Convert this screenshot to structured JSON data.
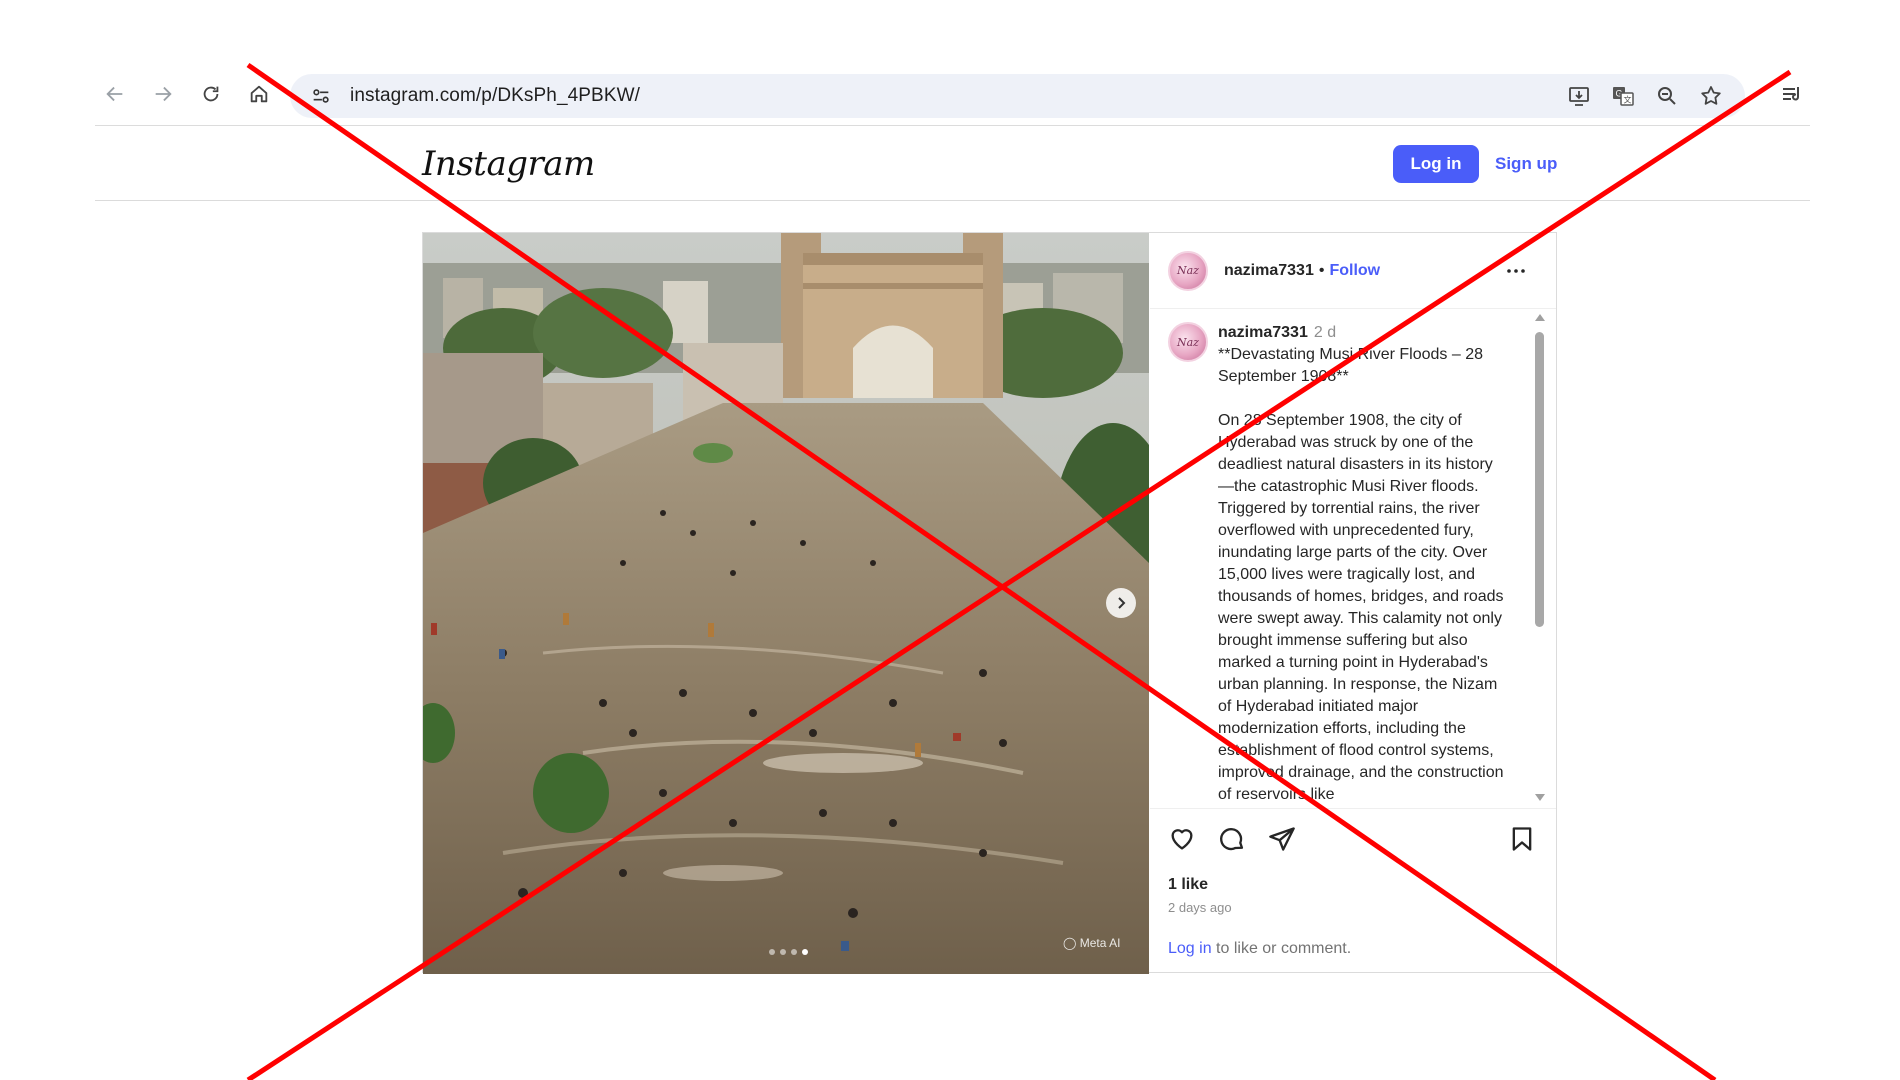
{
  "browser": {
    "url": "instagram.com/p/DKsPh_4PBKW/",
    "icons": [
      "back-arrow-icon",
      "forward-arrow-icon",
      "reload-icon",
      "home-icon",
      "site-info-icon",
      "install-app-icon",
      "translate-icon",
      "zoom-icon",
      "bookmark-star-icon",
      "reading-list-icon"
    ]
  },
  "header": {
    "logo": "Instagram",
    "login_label": "Log in",
    "signup_label": "Sign up",
    "accent_color": "#4a5df9"
  },
  "post": {
    "username": "nazima7331",
    "separator": "•",
    "follow_label": "Follow",
    "avatar_text": "Naz",
    "caption": {
      "username": "nazima7331",
      "time": "2 d",
      "text": "**Devastating Musi River Floods – 28 September 1908**\n\nOn 28 September 1908, the city of Hyderabad was struck by one of the deadliest natural disasters in its history—the catastrophic Musi River floods. Triggered by torrential rains, the river overflowed with unprecedented fury, inundating large parts of the city. Over 15,000 lives were tragically lost, and thousands of homes, bridges, and roads were swept away. This calamity not only brought immense suffering but also marked a turning point in Hyderabad's urban planning. In response, the Nizam of Hyderabad initiated major modernization efforts, including the establishment of flood control systems, improved drainage, and the construction of reservoirs like"
    },
    "likes": "1 like",
    "posted_ago": "2 days ago",
    "comment_prompt": {
      "link": "Log in",
      "rest": " to like or comment."
    },
    "media": {
      "watermark": "Meta AI",
      "carousel_count": 4,
      "carousel_active": 4
    }
  },
  "overlay": {
    "type": "red-cross",
    "color": "#ff0000"
  }
}
